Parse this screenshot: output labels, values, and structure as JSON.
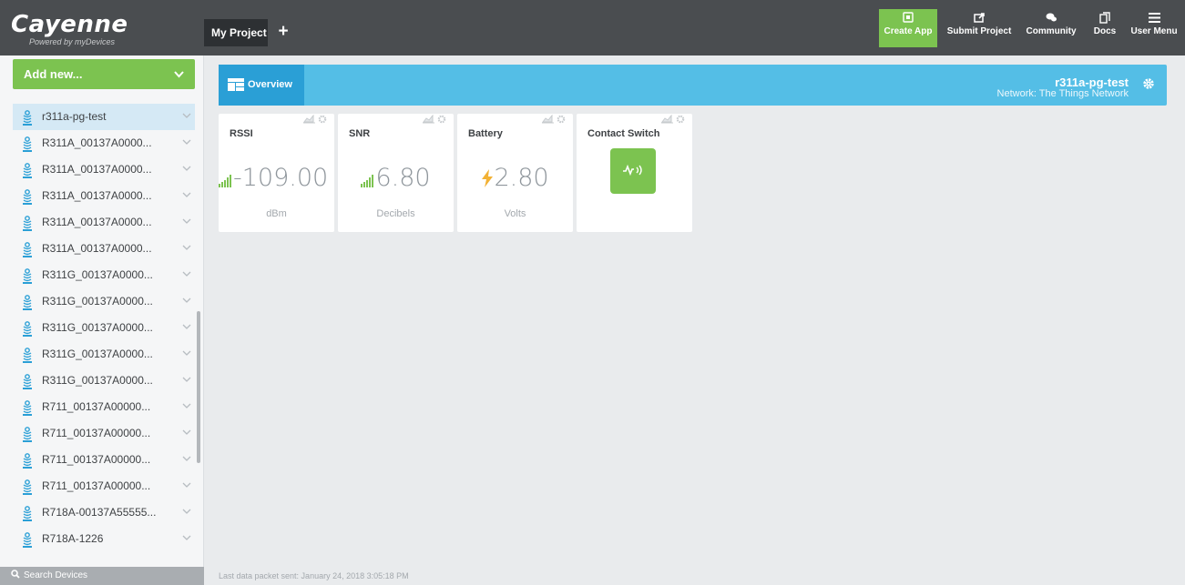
{
  "app": {
    "logo": "Cayenne",
    "logo_sub": "Powered by myDevices",
    "project_tab": "My Project",
    "project_add": "+"
  },
  "nav": {
    "create_app": "Create App",
    "submit_project": "Submit Project",
    "community": "Community",
    "docs": "Docs",
    "user_menu": "User Menu"
  },
  "sidebar": {
    "add_new": "Add new...",
    "devices": [
      "r311a-pg-test",
      "R311A_00137A0000...",
      "R311A_00137A0000...",
      "R311A_00137A0000...",
      "R311A_00137A0000...",
      "R311A_00137A0000...",
      "R311G_00137A0000...",
      "R311G_00137A0000...",
      "R311G_00137A0000...",
      "R311G_00137A0000...",
      "R311G_00137A0000...",
      "R711_00137A00000...",
      "R711_00137A00000...",
      "R711_00137A00000...",
      "R711_00137A00000...",
      "R718A-00137A55555...",
      "R718A-1226"
    ],
    "search": "Search Devices"
  },
  "overview": {
    "tab": "Overview",
    "device_name": "r311a-pg-test",
    "network": "Network: The Things Network"
  },
  "widgets": [
    {
      "title": "RSSI",
      "value": "-109.00",
      "unit": "dBm"
    },
    {
      "title": "SNR",
      "value": "6.80",
      "unit": "Decibels"
    },
    {
      "title": "Battery",
      "value": "2.80",
      "unit": "Volts"
    },
    {
      "title": "Contact Switch"
    }
  ],
  "footer": {
    "last_packet": "Last data packet sent: January 24, 2018 3:05:18 PM"
  },
  "colors": {
    "brand_green": "#7cc350",
    "header_blue": "#54bee6",
    "topbar": "#4a4d50"
  }
}
